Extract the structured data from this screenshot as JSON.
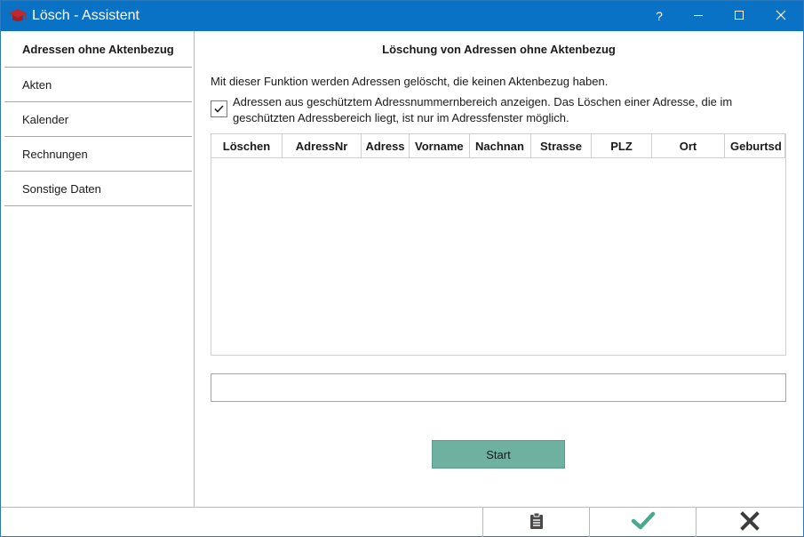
{
  "window": {
    "title": "Lösch - Assistent",
    "help_label": "?",
    "accent_color": "#0a72c4"
  },
  "sidebar": {
    "items": [
      {
        "label": "Adressen ohne Aktenbezug",
        "active": true
      },
      {
        "label": "Akten"
      },
      {
        "label": "Kalender"
      },
      {
        "label": "Rechnungen"
      },
      {
        "label": "Sonstige Daten"
      }
    ]
  },
  "main": {
    "title": "Löschung von Adressen ohne Aktenbezug",
    "description": "Mit dieser Funktion werden Adressen gelöscht, die keinen Aktenbezug haben.",
    "checkbox": {
      "checked": true,
      "label": "Adressen aus geschütztem Adressnummernbereich anzeigen. Das Löschen einer Adresse, die im geschützten Adressbereich liegt, ist nur im Adressfenster möglich."
    },
    "grid": {
      "columns": [
        "Löschen",
        "AdressNr",
        "Adress",
        "Vorname",
        "Nachnan",
        "Strasse",
        "PLZ",
        "Ort",
        "Geburtsd"
      ],
      "rows": []
    },
    "status_text": "",
    "start_label": "Start",
    "start_color": "#6fb1a0"
  },
  "footer": {
    "icons": [
      "clipboard-icon",
      "checkmark-icon",
      "close-x-icon"
    ],
    "confirm_color": "#4aa88f"
  }
}
